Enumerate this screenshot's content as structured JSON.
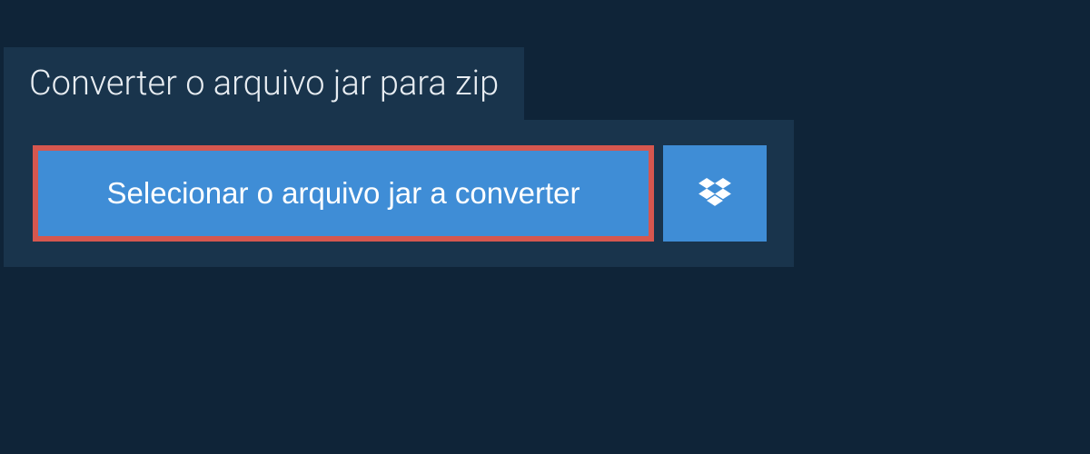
{
  "header": {
    "title": "Converter o arquivo jar para zip"
  },
  "actions": {
    "select_file_label": "Selecionar o arquivo jar a converter"
  },
  "colors": {
    "background": "#0f2438",
    "panel": "#19344c",
    "button": "#3f8dd6",
    "highlight_border": "#d6574f",
    "text_light": "#e8edf2"
  }
}
